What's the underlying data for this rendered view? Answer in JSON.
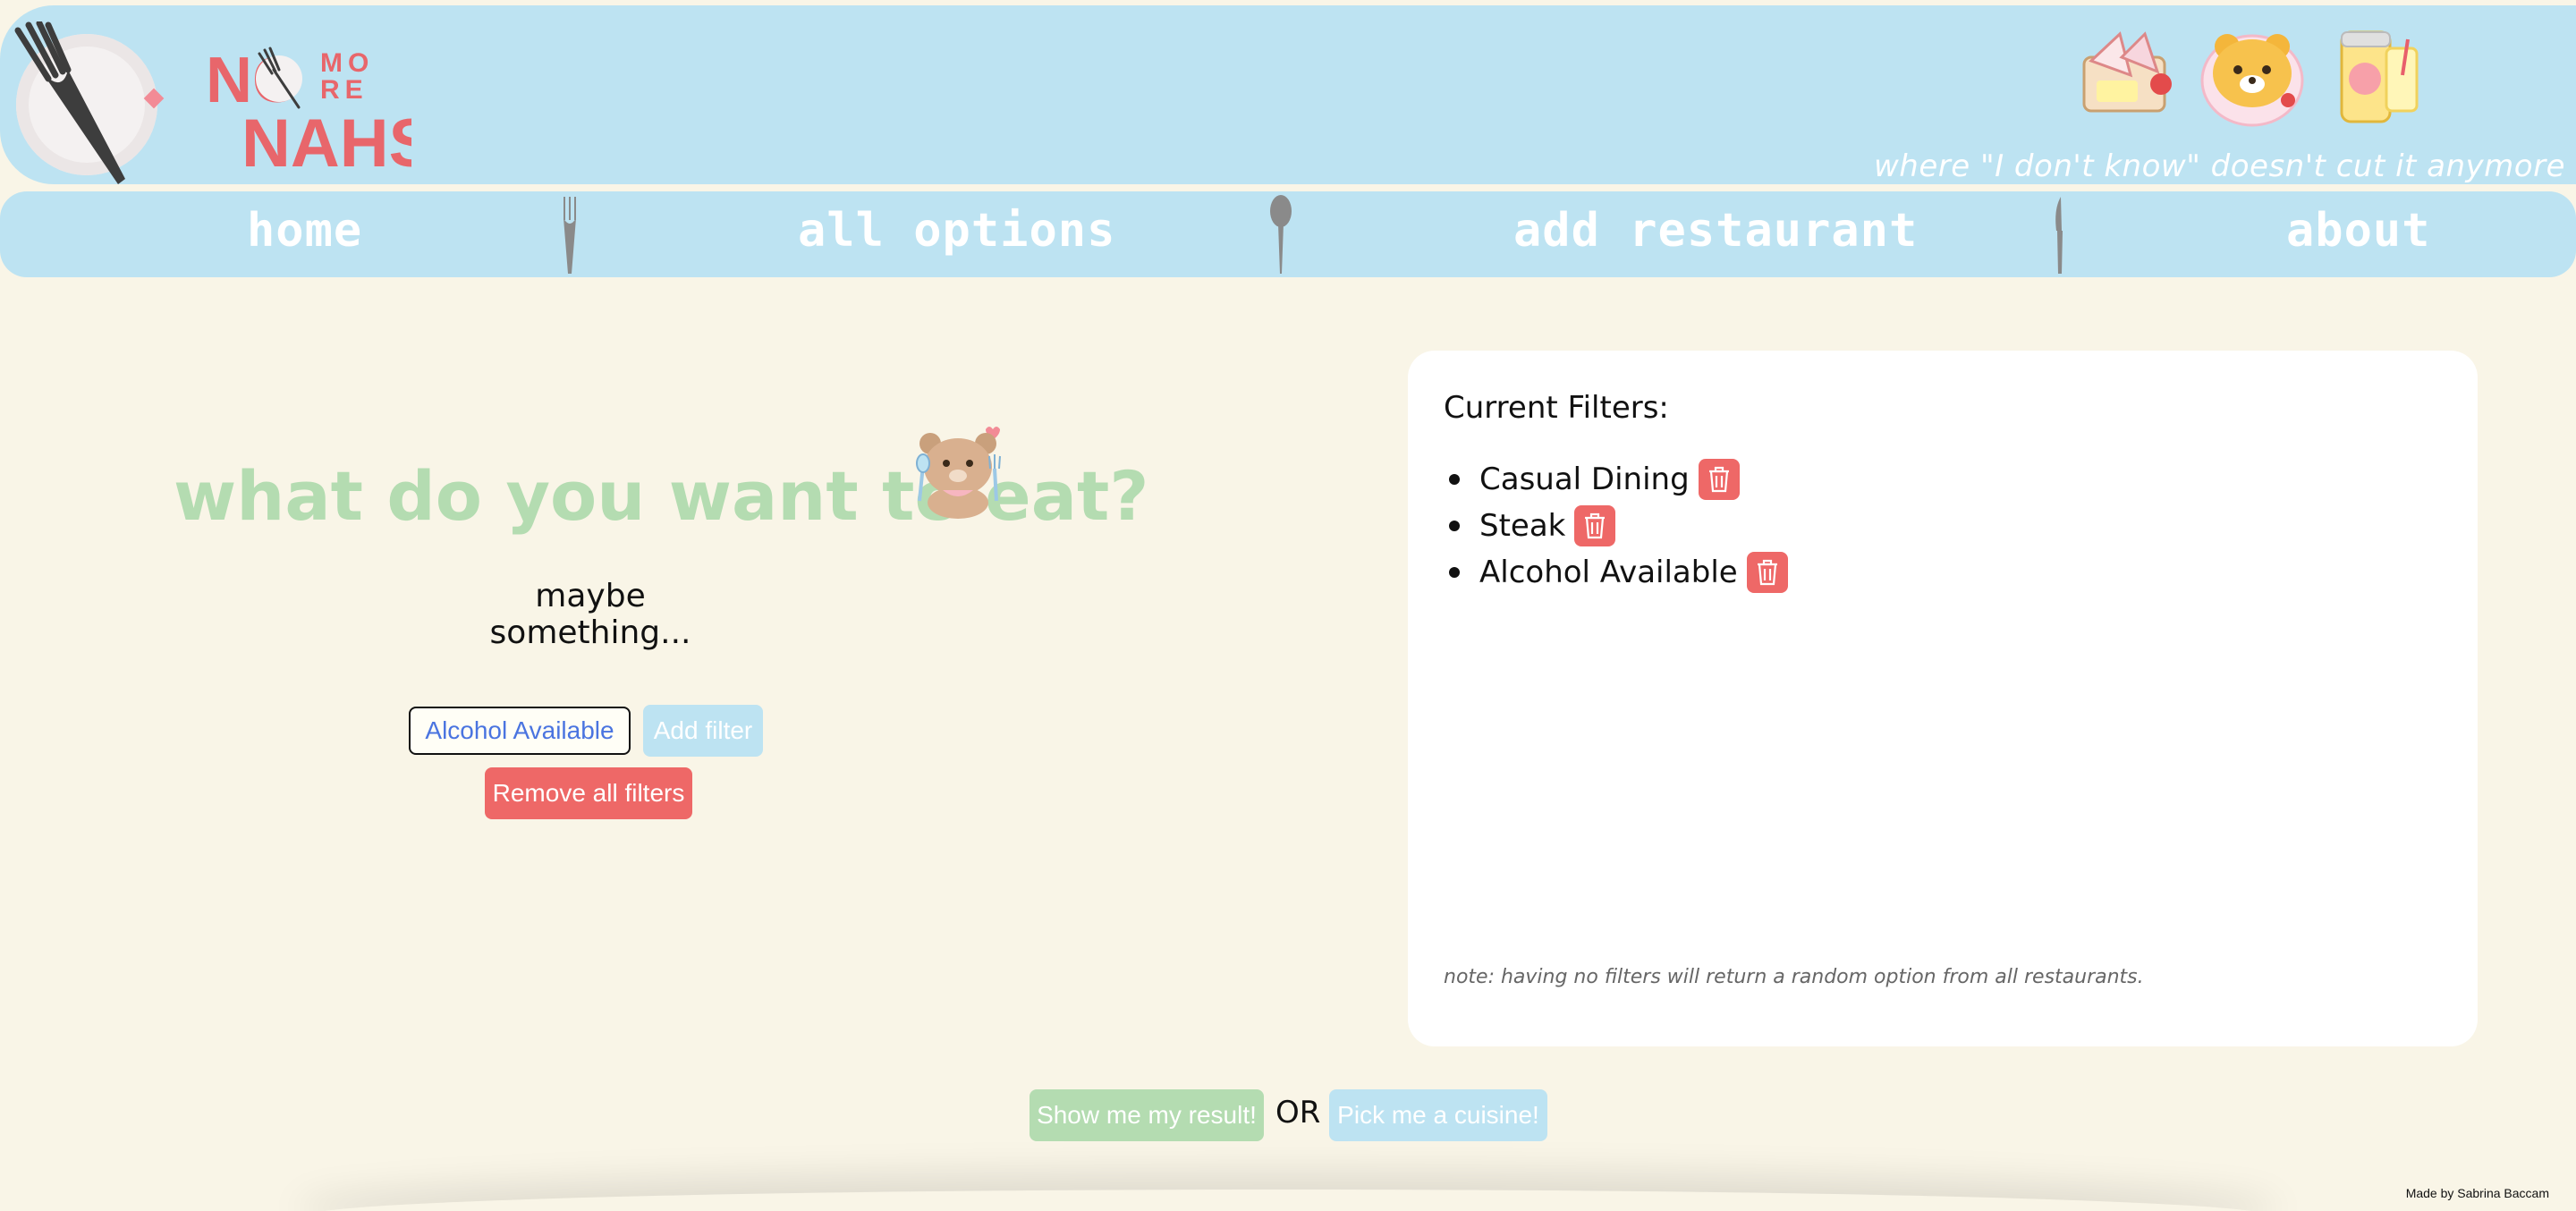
{
  "header": {
    "logo_text_no": "NO",
    "logo_text_more": "MORE",
    "logo_text_nahs": "NAHS",
    "tagline": "where \"I don't know\" doesn't cut it anymore",
    "food_icons": [
      "sandwich-icon",
      "bear-pancake-icon",
      "peach-drink-icon"
    ]
  },
  "nav": {
    "items": [
      {
        "label": "home"
      },
      {
        "label": "all options"
      },
      {
        "label": "add restaurant"
      },
      {
        "label": "about"
      }
    ]
  },
  "main": {
    "title": "what do you want to eat?",
    "subtitle": "maybe something...",
    "selected_filter": "Alcohol Available",
    "add_filter_label": "Add filter",
    "remove_all_label": "Remove all filters"
  },
  "filters": {
    "heading": "Current Filters:",
    "items": [
      "Casual Dining",
      "Steak",
      "Alcohol Available"
    ],
    "note": "note: having no filters will return a random option from all restaurants."
  },
  "actions": {
    "show_result_label": "Show me my result!",
    "or_label": "OR",
    "pick_cuisine_label": "Pick me a cuisine!"
  },
  "footer": {
    "credit": "Made by Sabrina Baccam"
  },
  "colors": {
    "header_blue": "#bde3f2",
    "background_cream": "#f9f5e7",
    "accent_green": "#b4dcb1",
    "accent_red": "#ee6867",
    "logo_red": "#e8666b"
  }
}
